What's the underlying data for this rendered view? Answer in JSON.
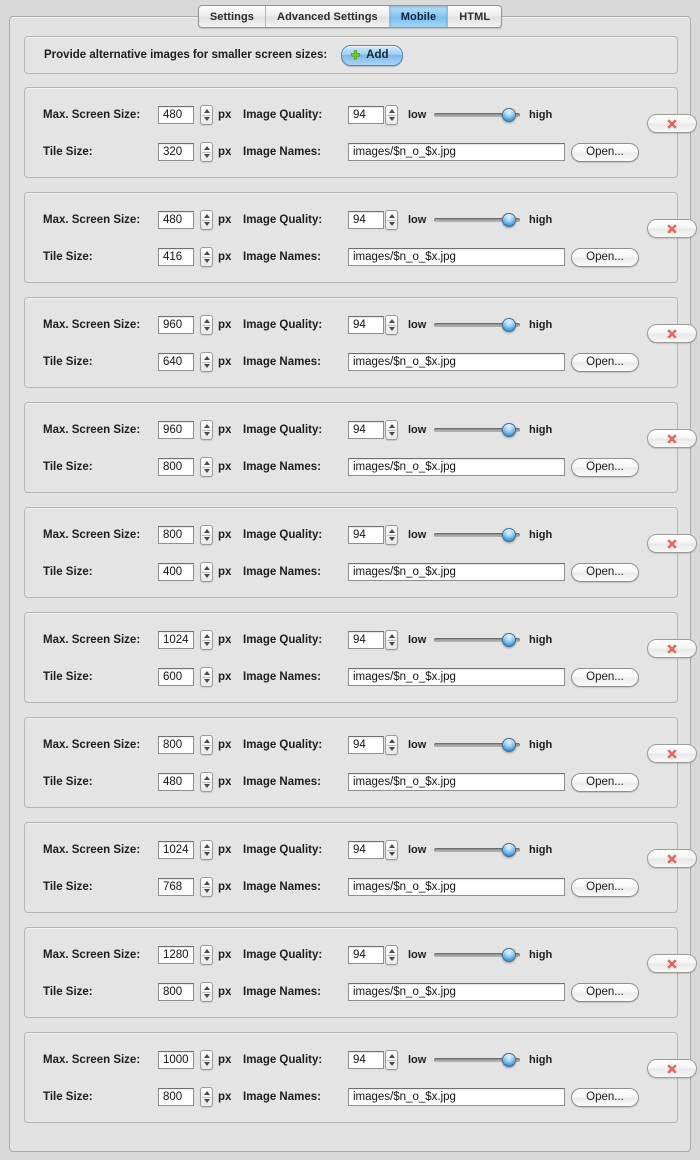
{
  "tabs": [
    {
      "label": "Settings",
      "active": false
    },
    {
      "label": "Advanced Settings",
      "active": false
    },
    {
      "label": "Mobile",
      "active": true
    },
    {
      "label": "HTML",
      "active": false
    }
  ],
  "header": {
    "text": "Provide alternative images for smaller screen sizes:",
    "add_label": "Add",
    "add_icon": "plus-icon"
  },
  "labels": {
    "max_screen_size": "Max. Screen Size:",
    "tile_size": "Tile Size:",
    "image_quality": "Image Quality:",
    "image_names": "Image Names:",
    "px": "px",
    "low": "low",
    "high": "high",
    "open": "Open...",
    "delete_icon": "close-x-icon"
  },
  "colors": {
    "accent": "#79bff0",
    "delete": "#e8645c",
    "add_plus": "#7fcc2a",
    "panel": "#e4e4e4",
    "page": "#d9d9d9"
  },
  "rows": [
    {
      "max_screen_size": "480",
      "tile_size": "320",
      "image_quality": "94",
      "image_names": "images/$n_o_$x.jpg",
      "quality_percent": 94
    },
    {
      "max_screen_size": "480",
      "tile_size": "416",
      "image_quality": "94",
      "image_names": "images/$n_o_$x.jpg",
      "quality_percent": 94
    },
    {
      "max_screen_size": "960",
      "tile_size": "640",
      "image_quality": "94",
      "image_names": "images/$n_o_$x.jpg",
      "quality_percent": 94
    },
    {
      "max_screen_size": "960",
      "tile_size": "800",
      "image_quality": "94",
      "image_names": "images/$n_o_$x.jpg",
      "quality_percent": 94
    },
    {
      "max_screen_size": "800",
      "tile_size": "400",
      "image_quality": "94",
      "image_names": "images/$n_o_$x.jpg",
      "quality_percent": 94
    },
    {
      "max_screen_size": "1024",
      "tile_size": "600",
      "image_quality": "94",
      "image_names": "images/$n_o_$x.jpg",
      "quality_percent": 94
    },
    {
      "max_screen_size": "800",
      "tile_size": "480",
      "image_quality": "94",
      "image_names": "images/$n_o_$x.jpg",
      "quality_percent": 94
    },
    {
      "max_screen_size": "1024",
      "tile_size": "768",
      "image_quality": "94",
      "image_names": "images/$n_o_$x.jpg",
      "quality_percent": 94
    },
    {
      "max_screen_size": "1280",
      "tile_size": "800",
      "image_quality": "94",
      "image_names": "images/$n_o_$x.jpg",
      "quality_percent": 94
    },
    {
      "max_screen_size": "1000",
      "tile_size": "800",
      "image_quality": "94",
      "image_names": "images/$n_o_$x.jpg",
      "quality_percent": 94
    }
  ]
}
